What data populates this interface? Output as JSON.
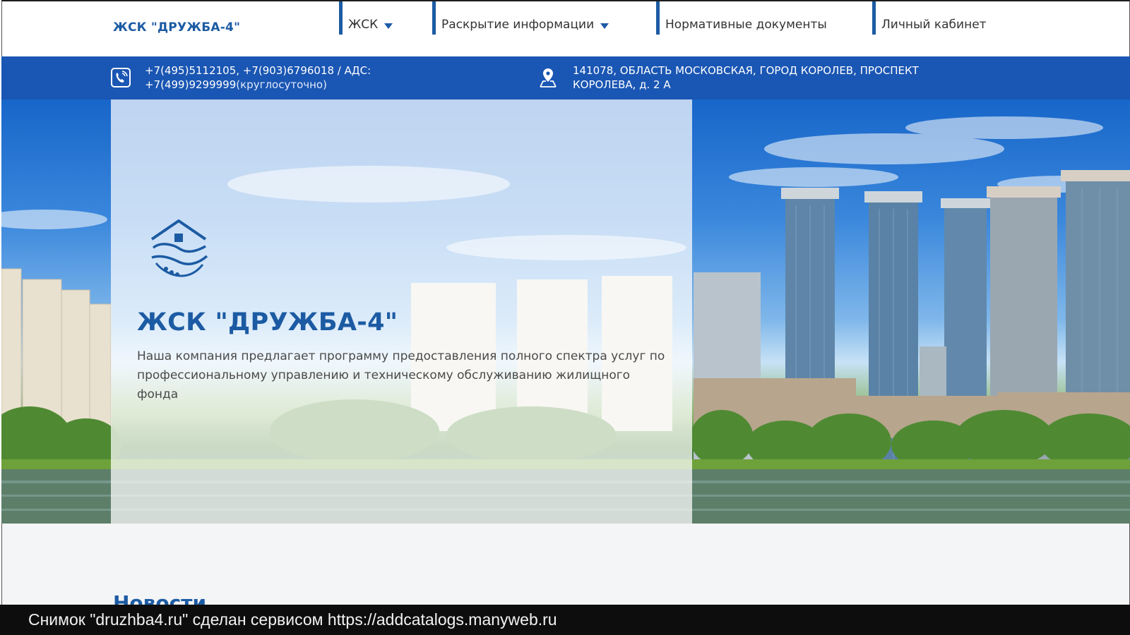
{
  "header": {
    "logo_text": "ЖСК \"ДРУЖБА-4\"",
    "nav": [
      {
        "label": "ЖСК",
        "has_dropdown": true
      },
      {
        "label": "Раскрытие информации",
        "has_dropdown": true
      },
      {
        "label": "Нормативные документы",
        "has_dropdown": false
      },
      {
        "label": "Личный кабинет",
        "has_dropdown": false
      }
    ]
  },
  "contacts": {
    "phone_icon": "phone-icon",
    "phone_line1": "+7(495)5112105, +7(903)6796018 / АДС:",
    "phone_line2_number": "+7(499)9299999",
    "phone_line2_note": "(круглосуточно)",
    "address_icon": "location-pin-icon",
    "address_line1": "141078, ОБЛАСТЬ МОСКОВСКАЯ, ГОРОД КОРОЛЕВ, ПРОСПЕКТ",
    "address_line2": "КОРОЛЕВА, д. 2 А"
  },
  "hero": {
    "logo_icon": "house-handshake-icon",
    "title": "ЖСК \"ДРУЖБА-4\"",
    "description": "Наша компания предлагает программу предоставления полного спектра услуг по профессиональному управлению и техническому обслуживанию жилищного фонда"
  },
  "news": {
    "title": "Новости"
  },
  "caption": {
    "text": "Снимок \"druzhba4.ru\" сделан сервисом https://addcatalogs.manyweb.ru"
  },
  "colors": {
    "brand": "#1c5ba3",
    "contact_bar": "#1a56b3"
  }
}
